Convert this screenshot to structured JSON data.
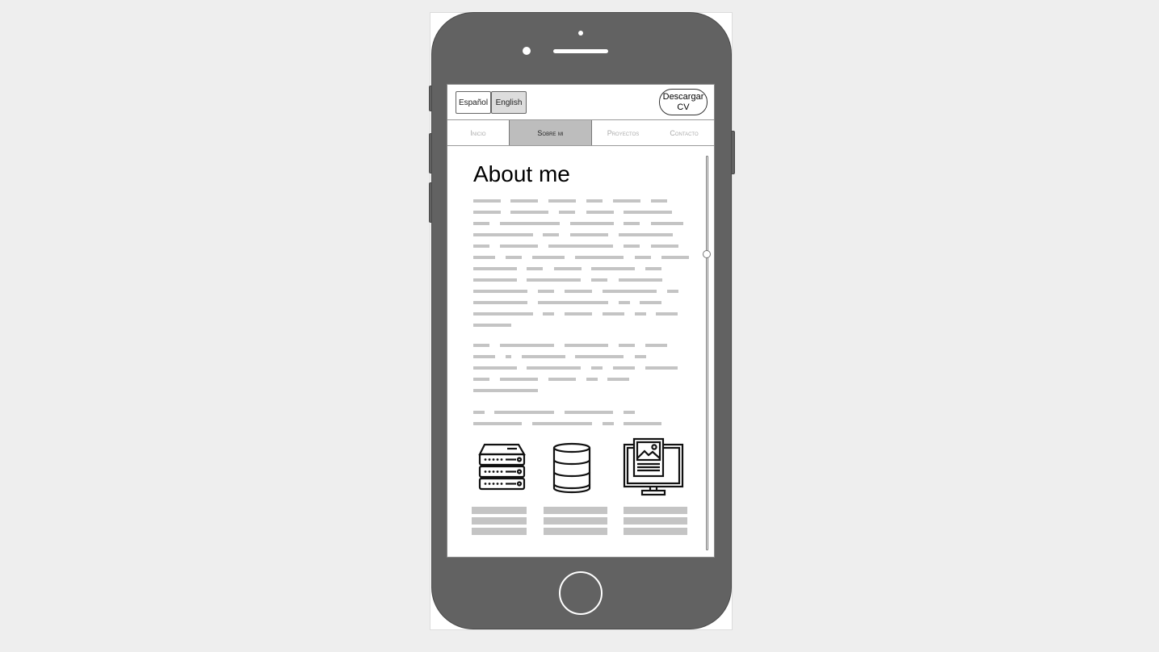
{
  "languages": [
    {
      "label": "Español",
      "active": false
    },
    {
      "label": "English",
      "active": true
    }
  ],
  "download_cv": {
    "line1": "Descargar",
    "line2": "CV"
  },
  "nav_tabs": [
    {
      "label": "Inicio",
      "active": false
    },
    {
      "label": "Sobre mi",
      "active": true
    },
    {
      "label": "Proyectos",
      "active": false
    },
    {
      "label": "Contacto",
      "active": false
    }
  ],
  "main": {
    "title": "About me"
  },
  "icons": [
    "server-rack-icon",
    "database-icon",
    "monitor-image-icon"
  ],
  "colors": {
    "phone_body": "#626262",
    "placeholder_text": "#c4c4c4",
    "active_tab": "#bdbdbd",
    "background": "#eeeeee"
  }
}
